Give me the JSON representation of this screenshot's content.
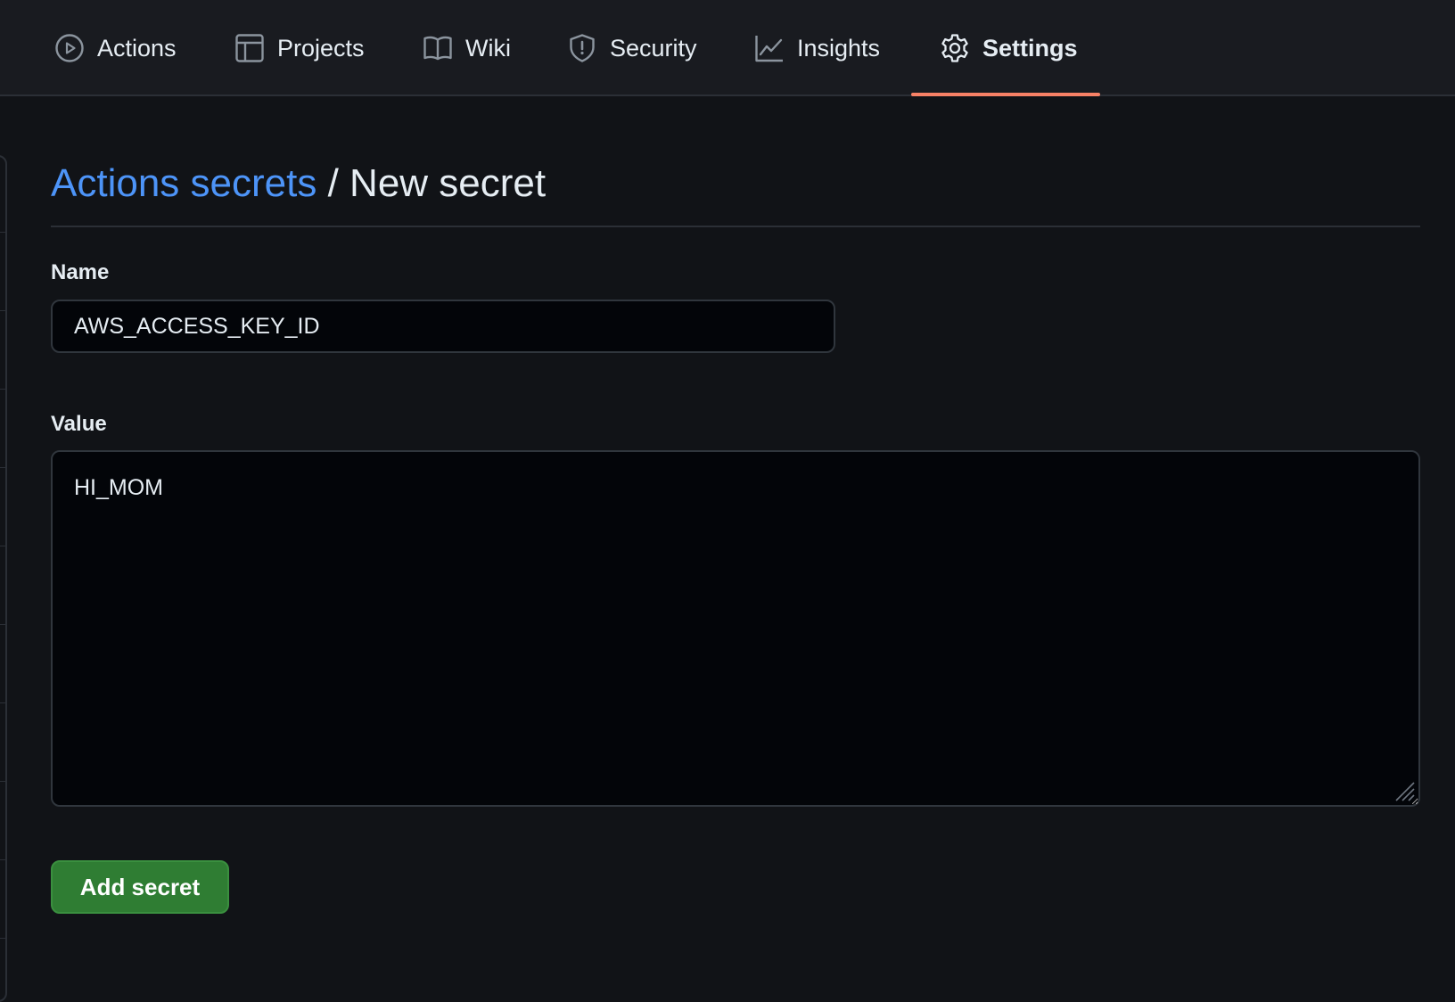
{
  "nav": {
    "tabs": [
      {
        "label": "Actions",
        "icon": "play-icon"
      },
      {
        "label": "Projects",
        "icon": "table-icon"
      },
      {
        "label": "Wiki",
        "icon": "book-icon"
      },
      {
        "label": "Security",
        "icon": "shield-icon"
      },
      {
        "label": "Insights",
        "icon": "graph-icon"
      },
      {
        "label": "Settings",
        "icon": "gear-icon",
        "active": true
      }
    ],
    "active_color": "#f78166"
  },
  "page": {
    "breadcrumb_link": "Actions secrets",
    "breadcrumb_separator": "/",
    "breadcrumb_current": "New secret",
    "link_color": "#4d94f8"
  },
  "form": {
    "name_label": "Name",
    "name_value": "AWS_ACCESS_KEY_ID",
    "value_label": "Value",
    "value_value": "HI_MOM",
    "submit_label": "Add secret",
    "submit_color": "#2f7d33"
  }
}
